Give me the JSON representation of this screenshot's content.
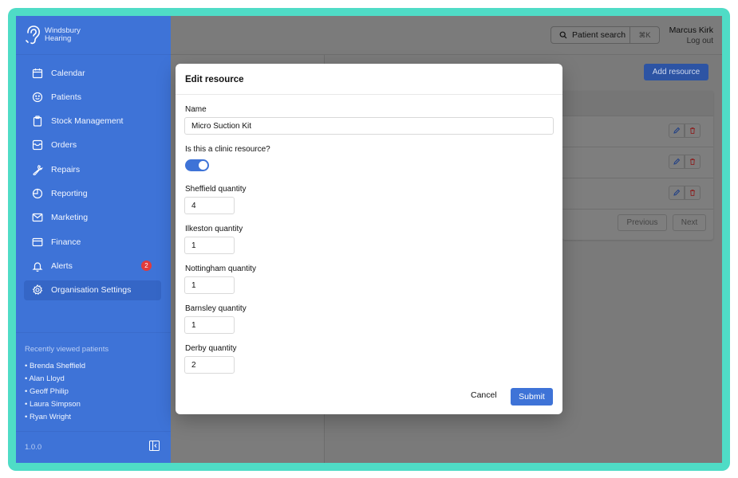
{
  "brand": {
    "line1": "Windsbury",
    "line2": "Hearing"
  },
  "nav": [
    {
      "label": "Calendar",
      "icon": "calendar-icon"
    },
    {
      "label": "Patients",
      "icon": "smile-icon"
    },
    {
      "label": "Stock Management",
      "icon": "clipboard-icon"
    },
    {
      "label": "Orders",
      "icon": "inbox-icon"
    },
    {
      "label": "Repairs",
      "icon": "wrench-icon"
    },
    {
      "label": "Reporting",
      "icon": "pie-chart-icon"
    },
    {
      "label": "Marketing",
      "icon": "envelope-icon"
    },
    {
      "label": "Finance",
      "icon": "credit-card-icon"
    },
    {
      "label": "Alerts",
      "icon": "bell-icon",
      "badge": "2"
    },
    {
      "label": "Organisation Settings",
      "icon": "gear-icon",
      "active": true
    }
  ],
  "recent": {
    "title": "Recently viewed patients",
    "patients": [
      "• Brenda Sheffield",
      "• Alan Lloyd",
      "• Geoff Philip",
      "• Laura Simpson",
      "• Ryan Wright"
    ]
  },
  "version": "1.0.0",
  "topbar": {
    "search_label": "Patient search",
    "search_shortcut": "⌘K",
    "user_name": "Marcus Kirk",
    "logout": "Log out"
  },
  "page": {
    "add_resource": "Add resource",
    "previous": "Previous",
    "next": "Next"
  },
  "modal": {
    "title": "Edit resource",
    "name_label": "Name",
    "name_value": "Micro Suction Kit",
    "clinic_label": "Is this a clinic resource?",
    "clinic_value": true,
    "quantities": [
      {
        "label": "Sheffield quantity",
        "value": "4"
      },
      {
        "label": "Ilkeston quantity",
        "value": "1"
      },
      {
        "label": "Nottingham quantity",
        "value": "1"
      },
      {
        "label": "Barnsley quantity",
        "value": "1"
      },
      {
        "label": "Derby quantity",
        "value": "2"
      }
    ],
    "cancel": "Cancel",
    "submit": "Submit"
  },
  "colors": {
    "sidebar": "#3e73d7",
    "accent": "#3e73d7",
    "frame": "#4fdcc6",
    "badge": "#e23b3b"
  }
}
